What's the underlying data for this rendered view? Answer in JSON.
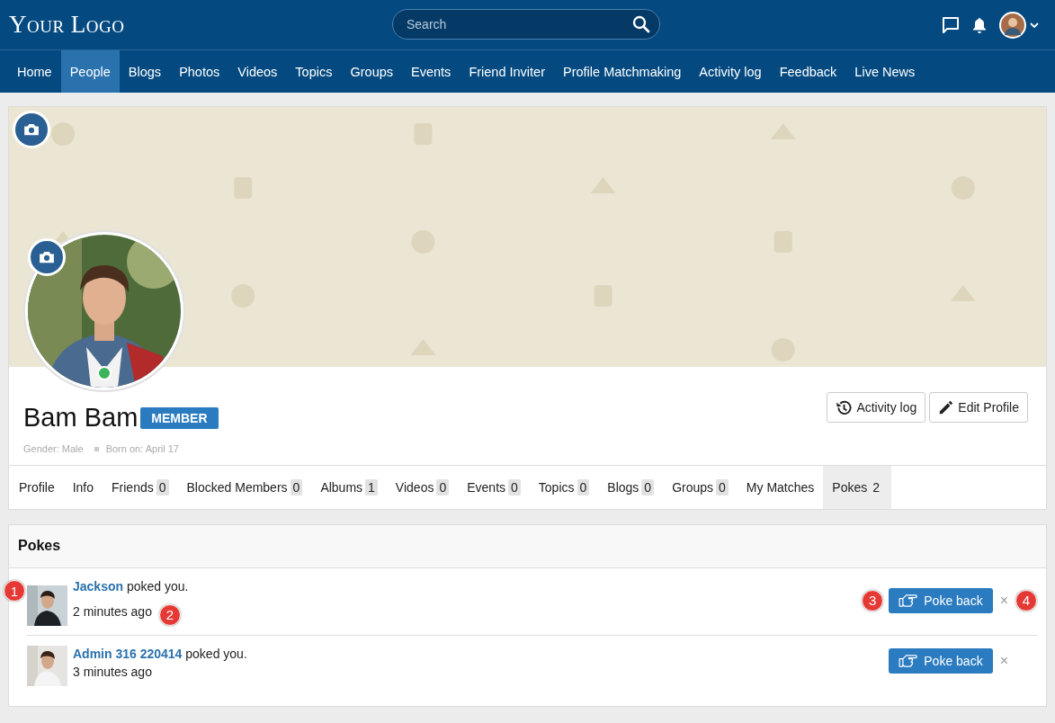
{
  "header": {
    "logo": "Your Logo",
    "search": {
      "placeholder": "Search"
    }
  },
  "nav": [
    {
      "label": "Home",
      "selected": false
    },
    {
      "label": "People",
      "selected": true
    },
    {
      "label": "Blogs",
      "selected": false
    },
    {
      "label": "Photos",
      "selected": false
    },
    {
      "label": "Videos",
      "selected": false
    },
    {
      "label": "Topics",
      "selected": false
    },
    {
      "label": "Groups",
      "selected": false
    },
    {
      "label": "Events",
      "selected": false
    },
    {
      "label": "Friend Inviter",
      "selected": false
    },
    {
      "label": "Profile Matchmaking",
      "selected": false
    },
    {
      "label": "Activity log",
      "selected": false
    },
    {
      "label": "Feedback",
      "selected": false
    },
    {
      "label": "Live News",
      "selected": false
    }
  ],
  "profile": {
    "name": "Bam Bam",
    "badge": "MEMBER",
    "online": true,
    "meta": [
      "Gender: Male",
      "Born on: April 17"
    ],
    "actions": [
      {
        "kind": "history",
        "label": "Activity log"
      },
      {
        "kind": "edit",
        "label": "Edit Profile"
      }
    ],
    "tabs": [
      {
        "label": "Profile",
        "selected": false
      },
      {
        "label": "Info",
        "selected": false
      },
      {
        "label": "Friends",
        "count": "0",
        "selected": false
      },
      {
        "label": "Blocked Members",
        "count": "0",
        "selected": false
      },
      {
        "label": "Albums",
        "count": "1",
        "selected": false
      },
      {
        "label": "Videos",
        "count": "0",
        "selected": false
      },
      {
        "label": "Events",
        "count": "0",
        "selected": false
      },
      {
        "label": "Topics",
        "count": "0",
        "selected": false
      },
      {
        "label": "Blogs",
        "count": "0",
        "selected": false
      },
      {
        "label": "Groups",
        "count": "0",
        "selected": false
      },
      {
        "label": "My Matches",
        "selected": false
      },
      {
        "label": "Pokes",
        "count": "2",
        "selected": true
      }
    ]
  },
  "pokes": {
    "title": "Pokes",
    "items": [
      {
        "name": "Jackson",
        "text": "poked you.",
        "time": "2 minutes ago",
        "button": "Poke back",
        "dismiss": "×",
        "callouts": {
          "avatar": "1",
          "time": "2",
          "button": "3",
          "dismiss": "4"
        }
      },
      {
        "name": "Admin 316 220414",
        "text": "poked you.",
        "time": "3 minutes ago",
        "button": "Poke back",
        "dismiss": "×"
      }
    ]
  }
}
